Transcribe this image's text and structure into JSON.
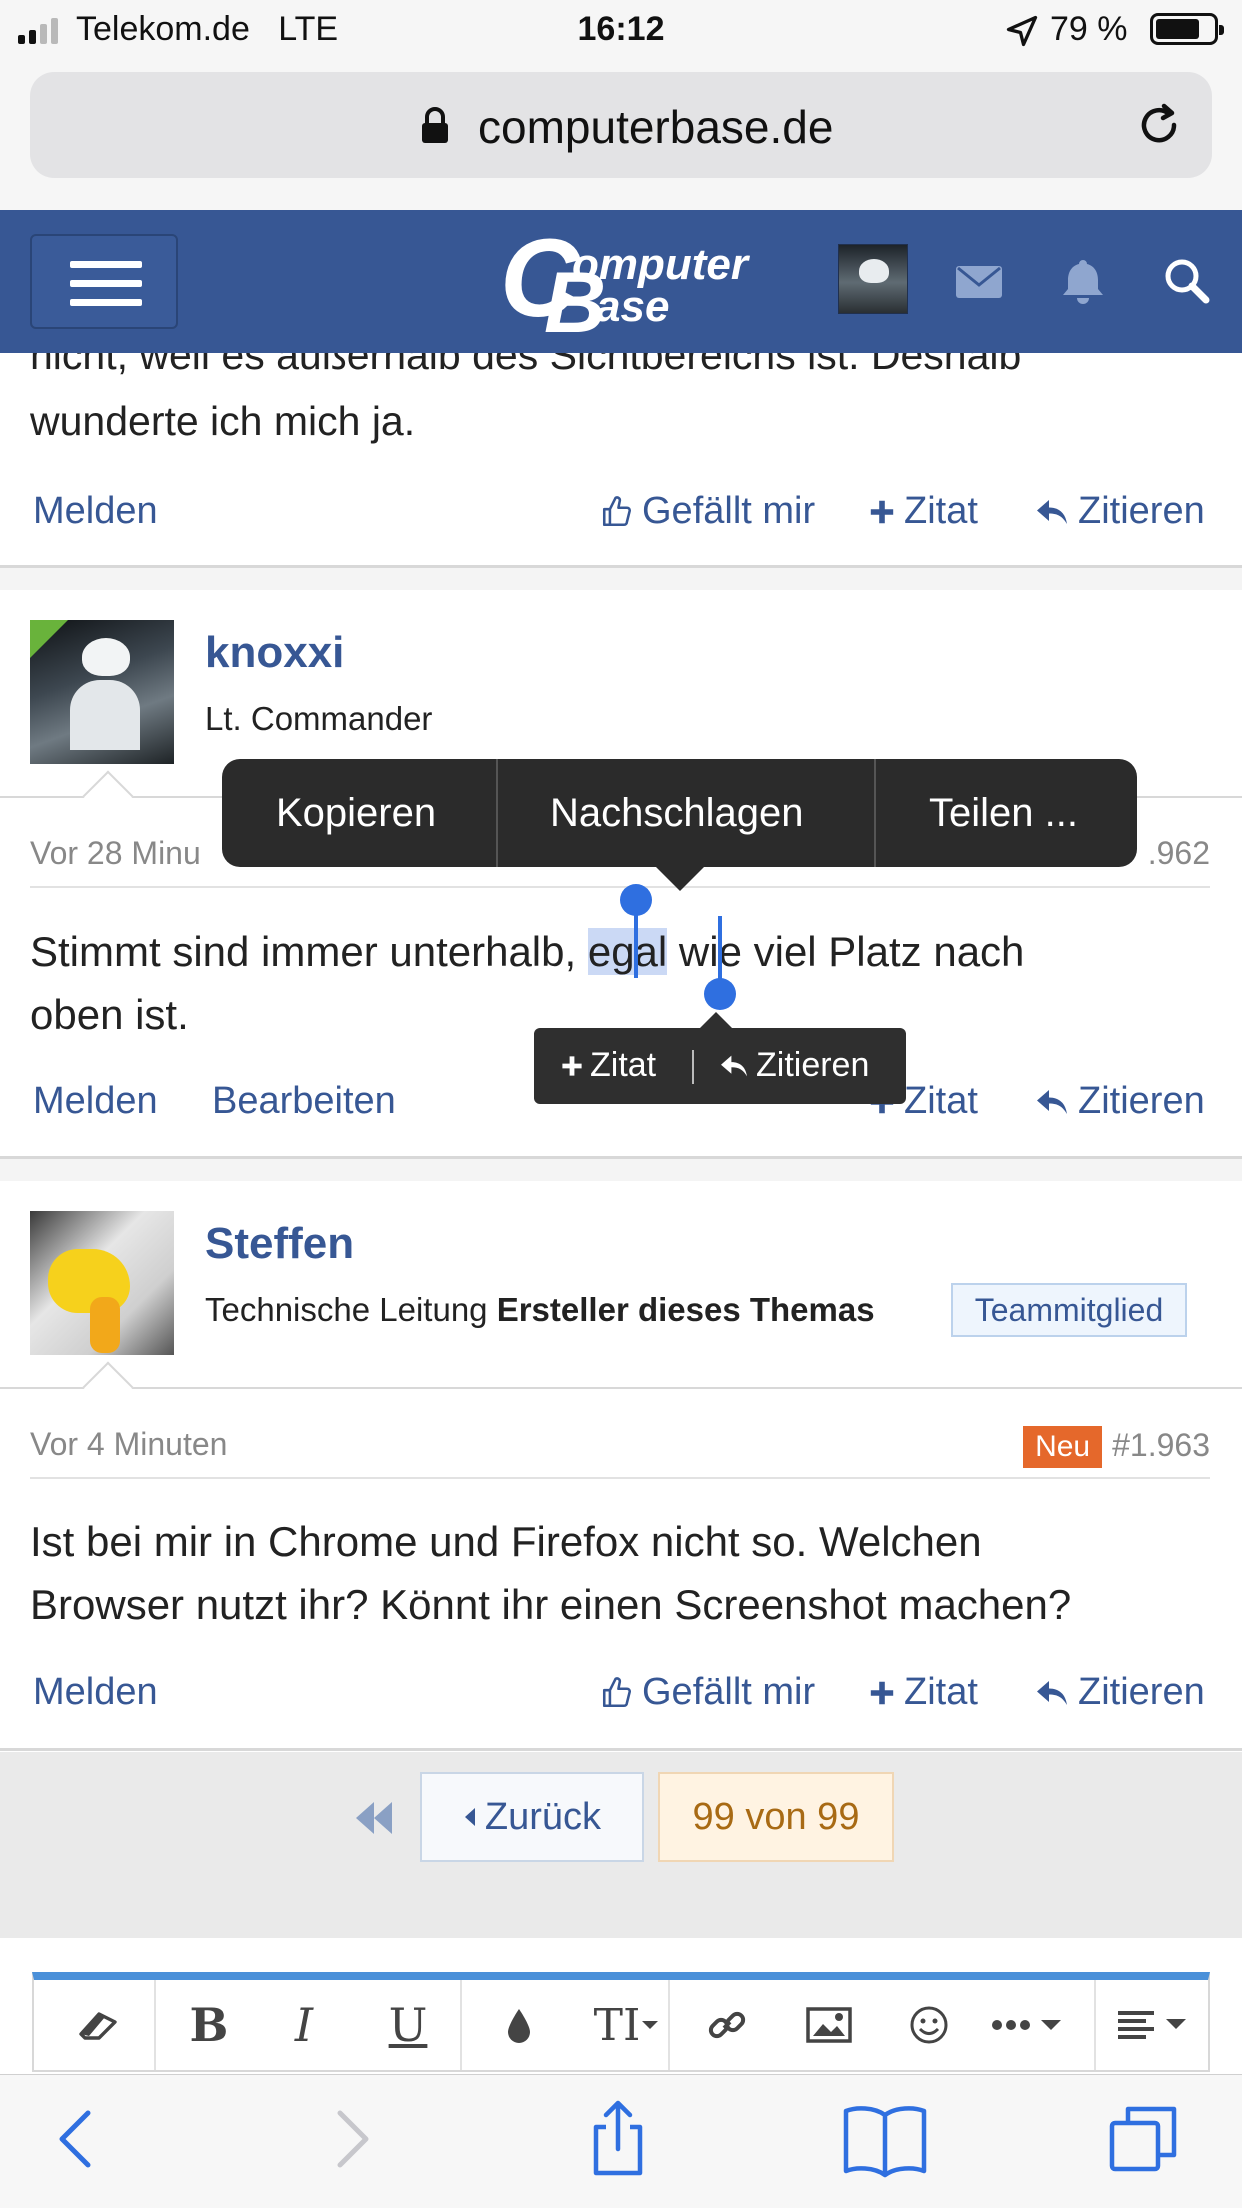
{
  "status_bar": {
    "carrier": "Telekom.de",
    "network": "LTE",
    "time": "16:12",
    "battery": "79 %",
    "battery_level": 0.79
  },
  "browser": {
    "url": "computerbase.de"
  },
  "site_header": {
    "logo_c": "C",
    "logo_line1": "omputer",
    "logo_b": "B",
    "logo_line2": "ase"
  },
  "previous_post": {
    "text_line1": "nicht, weil es außerhalb des Sichtbereichs ist. Deshalb",
    "text_line2": "wunderte ich mich ja.",
    "actions": {
      "report": "Melden",
      "like": "Gefällt mir",
      "quote": "Zitat",
      "reply": "Zitieren"
    }
  },
  "post_knoxxi": {
    "username": "knoxxi",
    "user_title": "Lt. Commander",
    "time": "Vor 28 Minu",
    "post_number": ".962",
    "text_before": "Stimmt sind immer unterhalb, ",
    "text_selected": "egal",
    "text_after": " wie viel Platz nach",
    "text_line2": "oben ist.",
    "actions": {
      "report": "Melden",
      "edit": "Bearbeiten",
      "quote": "Zitat",
      "reply": "Zitieren"
    }
  },
  "edit_menu": {
    "copy": "Kopieren",
    "lookup": "Nachschlagen",
    "share": "Teilen ..."
  },
  "quote_popup": {
    "quote": "Zitat",
    "reply": "Zitieren"
  },
  "post_steffen": {
    "username": "Steffen",
    "user_title": "Technische Leitung",
    "thread_starter": "Ersteller dieses Themas",
    "badge": "Teammitglied",
    "time": "Vor 4 Minuten",
    "new_badge": "Neu",
    "post_number": "#1.963",
    "text_line1": "Ist bei mir in Chrome und Firefox nicht so. Welchen",
    "text_line2": "Browser nutzt ihr? Könnt ihr einen Screenshot machen?",
    "actions": {
      "report": "Melden",
      "like": "Gefällt mir",
      "quote": "Zitat",
      "reply": "Zitieren"
    }
  },
  "pagination": {
    "back": "Zurück",
    "page": "99 von 99"
  },
  "editor_toolbar": {
    "bold": "B",
    "italic": "I",
    "underline": "U",
    "text_size": "TI"
  },
  "colors": {
    "header_blue": "#375794",
    "link_blue": "#375794",
    "new_orange": "#e5682b",
    "selection_blue": "#2f6fe0"
  }
}
